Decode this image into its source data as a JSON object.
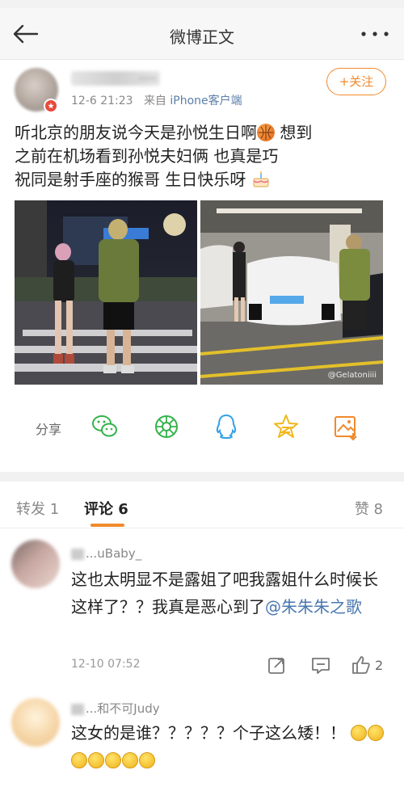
{
  "nav": {
    "title": "微博正文",
    "back_icon": "arrow-left-icon",
    "more_icon": "more-dots-icon"
  },
  "post": {
    "time": "12-6 21:23",
    "from_label": "来自",
    "source": "iPhone客户端",
    "follow_label": "+关注",
    "text_line1_a": "听北京的朋友说今天是孙悦生日啊",
    "text_line1_b": " 想到",
    "text_line2": "之前在机场看到孙悦夫妇俩 也真是巧",
    "text_line3": "祝同是射手座的猴哥 生日快乐呀",
    "watermark": "@Gelatoniiii",
    "name_partial": "....."
  },
  "share": {
    "label": "分享",
    "icons": [
      "wechat-icon",
      "moments-icon",
      "qq-icon",
      "qzone-star-icon",
      "save-image-icon"
    ]
  },
  "tabs": {
    "repost": "转发 1",
    "comment": "评论 6",
    "like": "赞 8"
  },
  "comments": [
    {
      "name": "...uBaby_",
      "text": "这也太明显不是露姐了吧我露姐什么时候长这样了？？我真是恶心到了",
      "mention": "@朱朱朱之歌",
      "time": "12-10 07:52",
      "likes": "2"
    },
    {
      "name": "...和不可Judy",
      "text": "这女的是谁？？？？？个子这么矮！！"
    }
  ],
  "colors": {
    "accent": "#f08a2c",
    "link": "#4a78b0",
    "source": "#5a7ea8"
  }
}
